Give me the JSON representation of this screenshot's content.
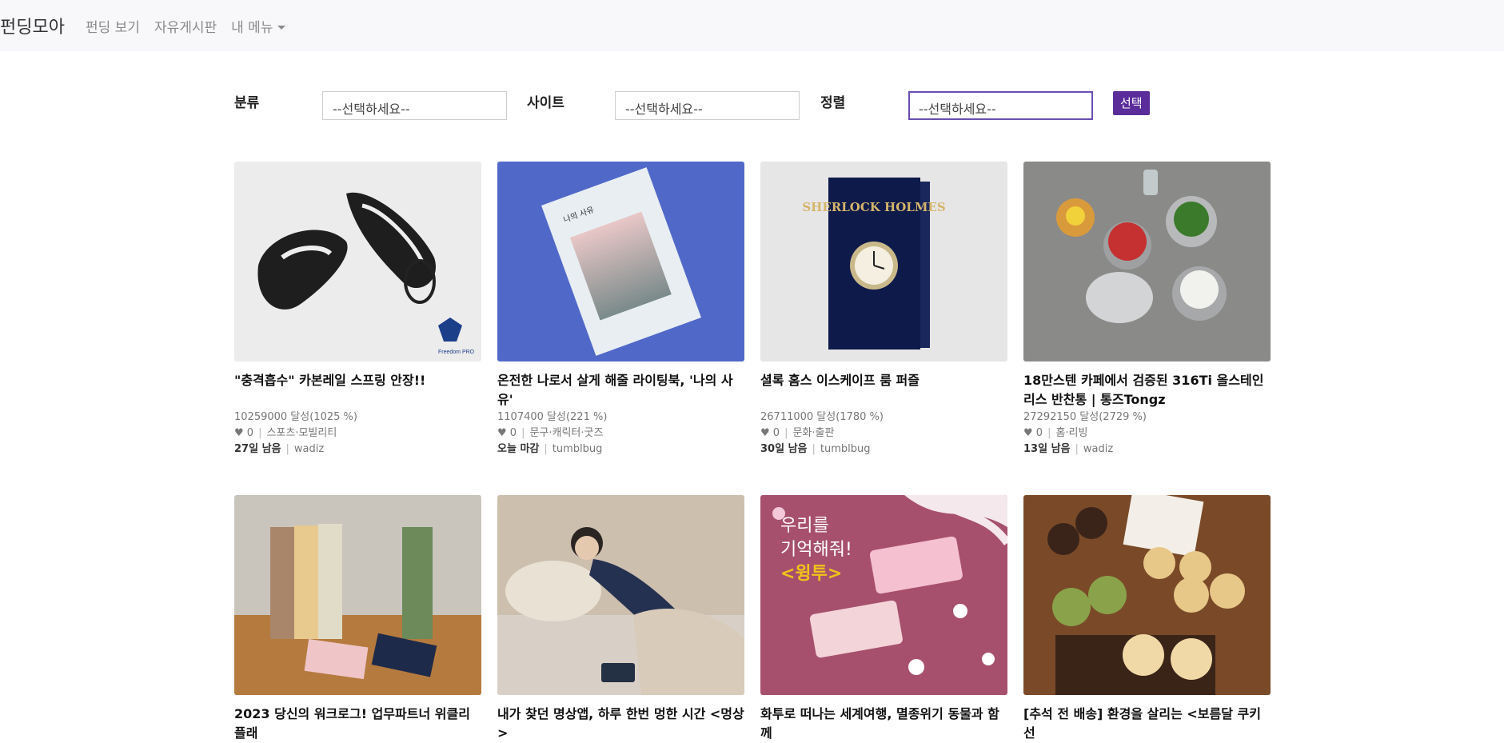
{
  "nav": {
    "brand": "펀딩모아",
    "links": [
      "펀딩 보기",
      "자유게시판"
    ],
    "menu": "내 메뉴"
  },
  "filters": {
    "category_label": "분류",
    "category_value": "--선택하세요--",
    "site_label": "사이트",
    "site_value": "--선택하세요--",
    "sort_label": "정렬",
    "sort_value": "--선택하세요--",
    "submit": "선택"
  },
  "colors": {
    "accent": "#5b2d9a",
    "nav_bg": "#f8f8fb"
  },
  "cards": [
    {
      "title": "\"충격흡수\" 카본레일 스프링 안장!!",
      "funding": "10259000 달성(1025 %)",
      "heart": "♥ 0",
      "category": "스포츠·모빌리티",
      "deadline": "27일 남음",
      "site": "wadiz"
    },
    {
      "title": "온전한 나로서 살게 해줄 라이팅북, '나의 사유'",
      "funding": "1107400 달성(221 %)",
      "heart": "♥ 0",
      "category": "문구·캐릭터·굿즈",
      "deadline": "오늘 마감",
      "site": "tumblbug"
    },
    {
      "title": "셜록 홈스 이스케이프 룸 퍼즐",
      "funding": "26711000 달성(1780 %)",
      "heart": "♥ 0",
      "category": "문화·출판",
      "deadline": "30일 남음",
      "site": "tumblbug"
    },
    {
      "title": "18만스텐 카페에서 검증된 316Ti 올스테인리스 반찬통 | 통즈Tongz",
      "funding": "27292150 달성(2729 %)",
      "heart": "♥ 0",
      "category": "홈·리빙",
      "deadline": "13일 남음",
      "site": "wadiz"
    },
    {
      "title": "2023 당신의 워크로그! 업무파트너 위클리플래",
      "funding": "",
      "heart": "",
      "category": "",
      "deadline": "",
      "site": ""
    },
    {
      "title": "내가 찾던 명상앱, 하루 한번 멍한 시간 <멍상>",
      "funding": "",
      "heart": "",
      "category": "",
      "deadline": "",
      "site": ""
    },
    {
      "title": "화투로 떠나는 세계여행, 멸종위기 동물과 함께",
      "funding": "",
      "heart": "",
      "category": "",
      "deadline": "",
      "site": ""
    },
    {
      "title": "[추석 전 배송] 환경을 살리는 <보름달 쿠키 선",
      "funding": "",
      "heart": "",
      "category": "",
      "deadline": "",
      "site": ""
    }
  ],
  "image_texts": {
    "card1_logo": "Freedom PRO",
    "card2_book": "나의 사유",
    "card3_book": "SHERLOCK HOLMES",
    "card7_line1": "우리를",
    "card7_line2": "기억해줘!",
    "card7_line3": "<윙투>"
  }
}
